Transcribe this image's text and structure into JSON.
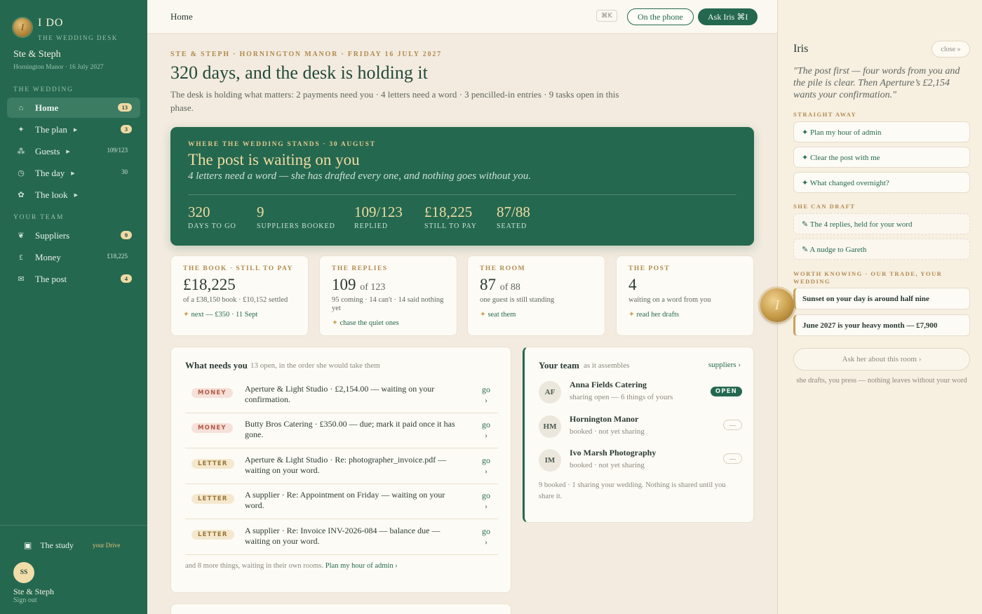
{
  "brand": {
    "name": "I DO",
    "subtitle": "THE WEDDING DESK",
    "seal": "I"
  },
  "couple": {
    "name": "Ste & Steph",
    "details": "Hornington Manor · 16 July 2027"
  },
  "nav": {
    "wedding_head": "THE WEDDING",
    "team_head": "YOUR TEAM",
    "items": [
      {
        "label": "Home",
        "icon": "home-icon",
        "glyph": "⌂",
        "badge": "13",
        "active": true
      },
      {
        "label": "The plan",
        "icon": "sparkle-icon",
        "glyph": "✦",
        "arrow": "▶",
        "badge": "3"
      },
      {
        "label": "Guests",
        "icon": "guests-icon",
        "glyph": "⁂",
        "arrow": "▶",
        "count": "109/123"
      },
      {
        "label": "The day",
        "icon": "clock-icon",
        "glyph": "◷",
        "arrow": "▶",
        "count": "30"
      },
      {
        "label": "The look",
        "icon": "flower-icon",
        "glyph": "✿",
        "arrow": "▶"
      },
      {
        "label": "Suppliers",
        "icon": "rosette-icon",
        "glyph": "❦",
        "badge": "9"
      },
      {
        "label": "Money",
        "icon": "pound-icon",
        "glyph": "£",
        "count": "£18,225"
      },
      {
        "label": "The post",
        "icon": "envelope-icon",
        "glyph": "✉",
        "badge": "4"
      }
    ],
    "study": {
      "label": "The study",
      "glyph": "▣",
      "note": "your Drive"
    }
  },
  "user": {
    "initials": "SS",
    "name": "Ste & Steph",
    "signout": "Sign out"
  },
  "topbar": {
    "crumb": "Home",
    "shortcut": "⌘K",
    "phone": "On the phone",
    "ask": "Ask Iris ⌘I"
  },
  "main": {
    "eyebrow": "STE & STEPH · HORNINGTON MANOR · FRIDAY 16 JULY 2027",
    "title": "320 days, and the desk is holding it",
    "lede": "The desk is holding what matters: 2 payments need you · 4 letters need a word · 3 pencilled-in entries · 9 tasks open in this phase."
  },
  "hero": {
    "eyebrow": "WHERE THE WEDDING STANDS · 30 AUGUST",
    "title": "The post is waiting on you",
    "subtitle": "4 letters need a word — she has drafted every one, and nothing goes without you.",
    "stats": [
      {
        "value": "320",
        "label": "DAYS TO GO"
      },
      {
        "value": "9",
        "label": "SUPPLIERS BOOKED"
      },
      {
        "value": "109/123",
        "label": "REPLIED"
      },
      {
        "value": "£18,225",
        "label": "STILL TO PAY"
      },
      {
        "value": "87/88",
        "label": "SEATED"
      }
    ]
  },
  "cards": [
    {
      "eyebrow": "THE BOOK · STILL TO PAY",
      "value": "£18,225",
      "of": "",
      "sub": "of a £38,150 book · £10,152 settled",
      "link": "next — £350 · 11 Sept"
    },
    {
      "eyebrow": "THE REPLIES",
      "value": "109",
      "of": "of 123",
      "sub": "95 coming · 14 can't · 14 said nothing yet",
      "link": "chase the quiet ones"
    },
    {
      "eyebrow": "THE ROOM",
      "value": "87",
      "of": "of 88",
      "sub": "one guest is still standing",
      "link": "seat them"
    },
    {
      "eyebrow": "THE POST",
      "value": "4",
      "of": "",
      "sub": "waiting on a word from you",
      "link": "read her drafts"
    }
  ],
  "needs": {
    "title": "What needs you",
    "hint": "13 open, in the order she would take them",
    "go": "go ›",
    "tasks": [
      {
        "tag": "MONEY",
        "kind": "money",
        "text": "Aperture & Light Studio · £2,154.00 — waiting on your confirmation."
      },
      {
        "tag": "MONEY",
        "kind": "money",
        "text": "Butty Bros Catering · £350.00 — due; mark it paid once it has gone."
      },
      {
        "tag": "LETTER",
        "kind": "letter",
        "text": "Aperture & Light Studio · Re: photographer_invoice.pdf — waiting on your word."
      },
      {
        "tag": "LETTER",
        "kind": "letter",
        "text": "A supplier · Re: Appointment on Friday — waiting on your word."
      },
      {
        "tag": "LETTER",
        "kind": "letter",
        "text": "A supplier · Re: Invoice INV-2026-084 — balance due — waiting on your word."
      }
    ],
    "foot": "and 8 more things, waiting in their own rooms.",
    "foot_link": "Plan my hour of admin ›"
  },
  "team": {
    "title": "Your team",
    "hint": "as it assembles",
    "link": "suppliers ›",
    "members": [
      {
        "initials": "AF",
        "name": "Anna Fields Catering",
        "sub": "sharing open — 6 things of yours",
        "status": "OPEN"
      },
      {
        "initials": "HM",
        "name": "Hornington Manor",
        "sub": "booked · not yet sharing",
        "status": "—"
      },
      {
        "initials": "IM",
        "name": "Ivo Marsh Photography",
        "sub": "booked · not yet sharing",
        "status": "—"
      }
    ],
    "foot": "9 booked · 1 sharing your wedding. Nothing is shared until you share it."
  },
  "iris": {
    "title": "Iris",
    "close": "close »",
    "quote": "\"The post first — four words from you and the pile is clear. Then Aperture’s £2,154 wants your confirmation.\"",
    "straight_head": "STRAIGHT AWAY",
    "straight": [
      "✦ Plan my hour of admin",
      "✦ Clear the post with me",
      "✦ What changed overnight?"
    ],
    "draft_head": "SHE CAN DRAFT",
    "drafts": [
      "✎ The 4 replies, held for your word",
      "✎ A nudge to Gareth"
    ],
    "worth_head": "WORTH KNOWING · OUR TRADE, YOUR WEDDING",
    "worth": [
      "Sunset on your day is around half nine",
      "June 2027 is your heavy month — £7,900"
    ],
    "ask": "Ask her about this room ›",
    "foot": "she drafts, you press — nothing leaves without your word",
    "seal": "I"
  },
  "colors": {
    "forest": "#24684f",
    "gold": "#c9a25c",
    "cream": "#f3ebdf",
    "money": "#b25a46"
  }
}
